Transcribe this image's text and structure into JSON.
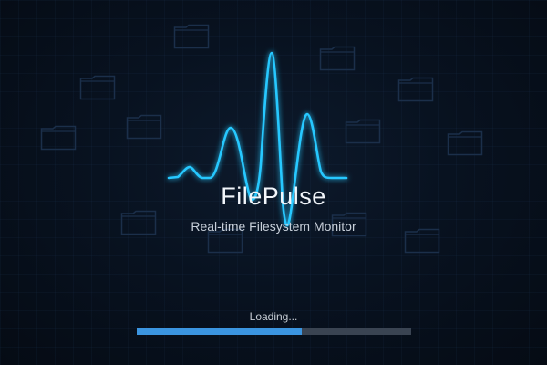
{
  "app": {
    "title": "FilePulse",
    "subtitle": "Real-time Filesystem Monitor"
  },
  "loading": {
    "label": "Loading...",
    "progress_fraction": 0.6
  },
  "decorations": {
    "folder_icon": "folder-outline-icon",
    "pulse_icon": "heartbeat-waveform"
  },
  "colors": {
    "background": "#060d18",
    "pulse": "#28c8ff",
    "pulse_glow": "#1a8fd8",
    "folder_outline": "#1b2f4a",
    "progress_fill": "#3b95e0",
    "progress_track": "#3a4452",
    "title_text": "#f1f5fa"
  }
}
